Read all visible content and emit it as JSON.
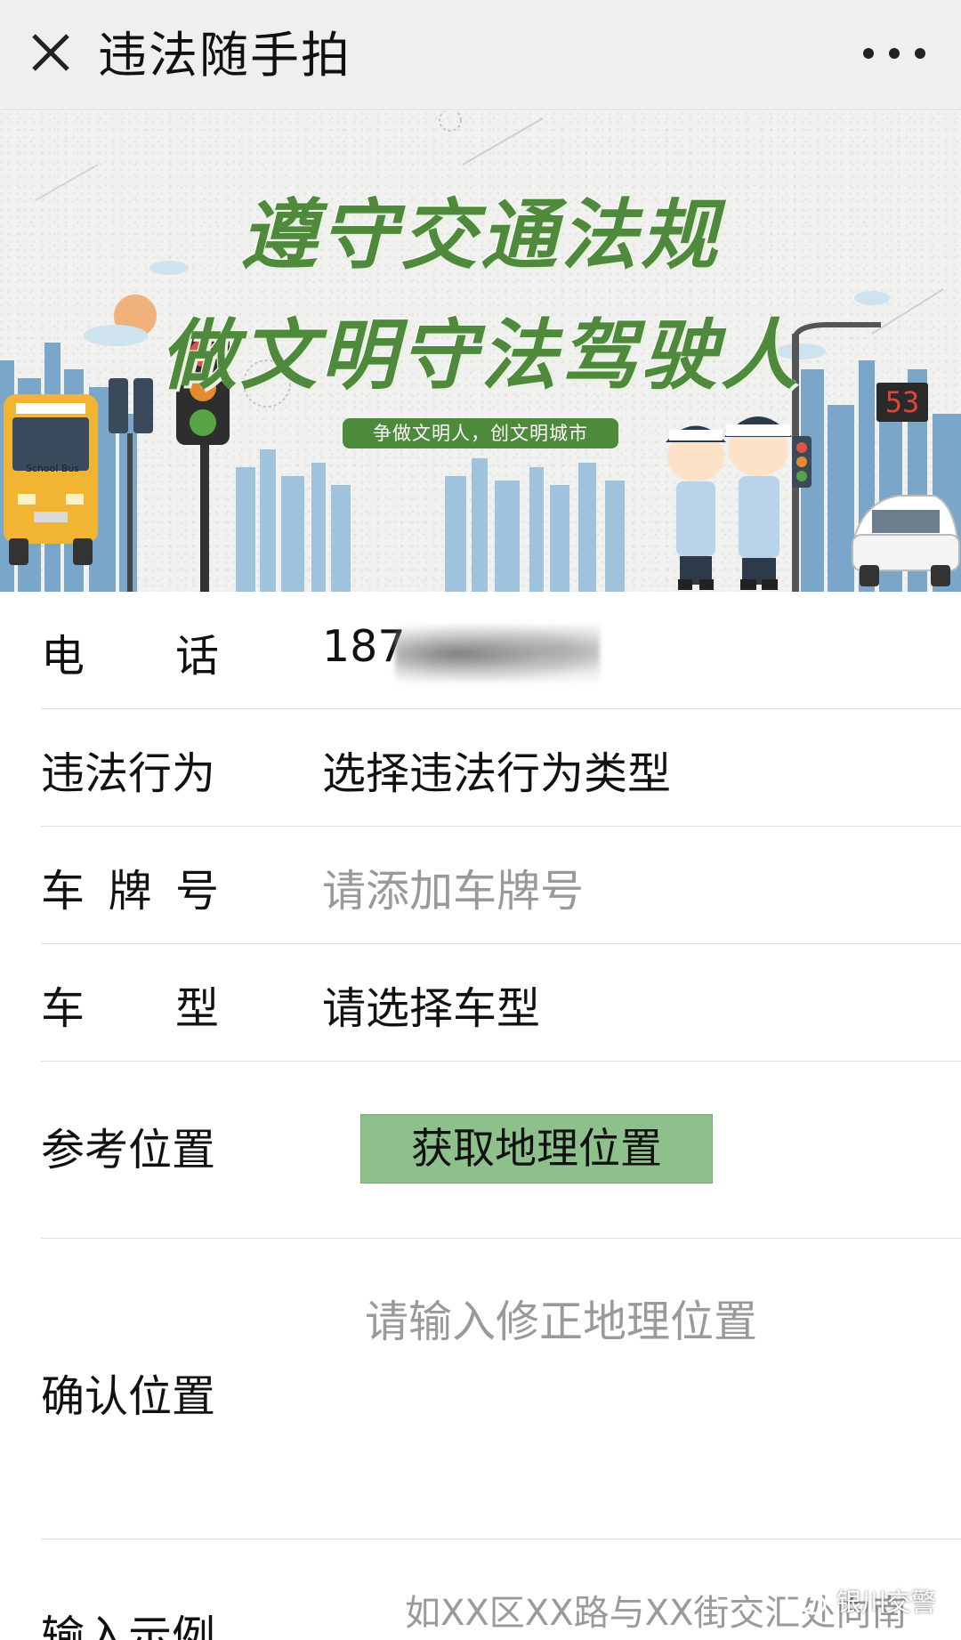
{
  "topbar": {
    "title": "违法随手拍"
  },
  "banner": {
    "title_line1": "遵守交通法规",
    "title_line2": "做文明守法驾驶人",
    "slogan": "争做文明人，创文明城市",
    "speed_sign": "53",
    "bus_label": "School Bus"
  },
  "form": {
    "phone": {
      "label_chars": [
        "电",
        "话"
      ],
      "value": "187"
    },
    "violation": {
      "label": "违法行为",
      "value": "选择违法行为类型"
    },
    "plate": {
      "label_chars": [
        "车",
        "牌",
        "号"
      ],
      "placeholder": "请添加车牌号"
    },
    "car_type": {
      "label_chars": [
        "车",
        "型"
      ],
      "value": "请选择车型"
    },
    "reference_location": {
      "label": "参考位置",
      "button": "获取地理位置"
    },
    "confirm_location": {
      "label": "确认位置",
      "placeholder": "请输入修正地理位置"
    },
    "example": {
      "label": "输入示例",
      "value": "如XX区XX路与XX街交汇处向南"
    }
  },
  "watermark": {
    "text": "银川交警"
  },
  "colors": {
    "accent_green": "#8dc08b",
    "banner_green": "#4f8a3c"
  }
}
